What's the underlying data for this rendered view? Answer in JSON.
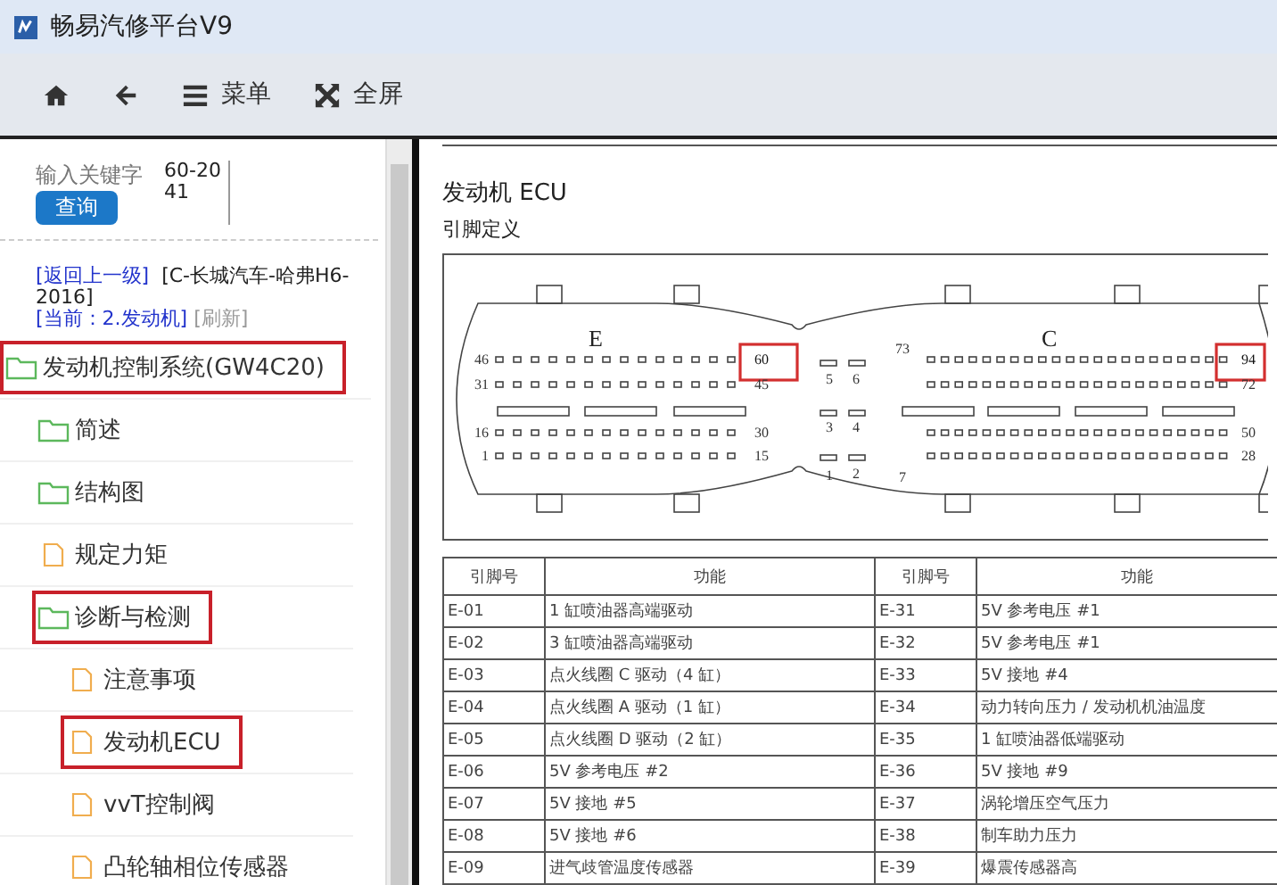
{
  "window": {
    "title": "畅易汽修平台V9"
  },
  "toolbar": {
    "menu_label": "菜单",
    "fullscreen_label": "全屏"
  },
  "search": {
    "placeholder": "输入关键字",
    "value": "60-2041",
    "button": "查询"
  },
  "breadcrumb": {
    "back_link": "[返回上一级]",
    "path": "[C-长城汽车-哈弗H6-2016]",
    "current": "[当前：2.发动机]",
    "refresh": "[刷新]"
  },
  "tree": [
    {
      "label": "发动机控制系统(GW4C20)",
      "kind": "folder",
      "highlighted": true,
      "children": [
        {
          "label": "简述",
          "kind": "folder",
          "highlighted": false
        },
        {
          "label": "结构图",
          "kind": "folder",
          "highlighted": false
        },
        {
          "label": "规定力矩",
          "kind": "document",
          "highlighted": false
        },
        {
          "label": "诊断与检测",
          "kind": "folder",
          "highlighted": true,
          "children": [
            {
              "label": "注意事项",
              "kind": "document",
              "highlighted": false
            },
            {
              "label": "发动机ECU",
              "kind": "document",
              "highlighted": true
            },
            {
              "label": "vvT控制阀",
              "kind": "document",
              "highlighted": false
            },
            {
              "label": "凸轮轴相位传感器",
              "kind": "document",
              "highlighted": false
            }
          ]
        }
      ]
    }
  ],
  "document": {
    "title": "发动机 ECU",
    "subtitle": "引脚定义",
    "connector": {
      "sections": [
        {
          "label": "E",
          "rows": [
            {
              "start": "46",
              "end": "60",
              "end_highlighted": true
            },
            {
              "start": "31",
              "end": "45",
              "end_highlighted": false
            },
            {
              "start": "16",
              "end": "30",
              "end_highlighted": false
            },
            {
              "start": "1",
              "end": "15",
              "end_highlighted": false
            }
          ]
        },
        {
          "label": "C",
          "top_mark": "73",
          "bottom_mark": "7",
          "rows": [
            {
              "end": "94",
              "end_highlighted": true
            },
            {
              "end": "72",
              "end_highlighted": false
            },
            {
              "end": "50",
              "end_highlighted": false
            },
            {
              "end": "28",
              "end_highlighted": false
            }
          ]
        }
      ],
      "middle_pairs": [
        [
          "5",
          "6"
        ],
        [
          "3",
          "4"
        ],
        [
          "1",
          "2"
        ]
      ]
    },
    "table": {
      "columns": [
        "引脚号",
        "功能",
        "引脚号",
        "功能"
      ],
      "rows": [
        [
          "E-01",
          "1 缸喷油器高端驱动",
          "E-31",
          "5V 参考电压 #1"
        ],
        [
          "E-02",
          "3 缸喷油器高端驱动",
          "E-32",
          "5V 参考电压 #1"
        ],
        [
          "E-03",
          "点火线圈 C 驱动（4 缸）",
          "E-33",
          "5V 接地 #4"
        ],
        [
          "E-04",
          "点火线圈 A 驱动（1 缸）",
          "E-34",
          "动力转向压力 / 发动机机油温度"
        ],
        [
          "E-05",
          "点火线圈 D 驱动（2 缸）",
          "E-35",
          "1 缸喷油器低端驱动"
        ],
        [
          "E-06",
          "5V 参考电压 #2",
          "E-36",
          "5V 接地 #9"
        ],
        [
          "E-07",
          "5V 接地 #5",
          "E-37",
          "涡轮增压空气压力"
        ],
        [
          "E-08",
          "5V 接地 #6",
          "E-38",
          "制车助力压力"
        ],
        [
          "E-09",
          "进气歧管温度传感器",
          "E-39",
          "爆震传感器高"
        ]
      ]
    }
  }
}
